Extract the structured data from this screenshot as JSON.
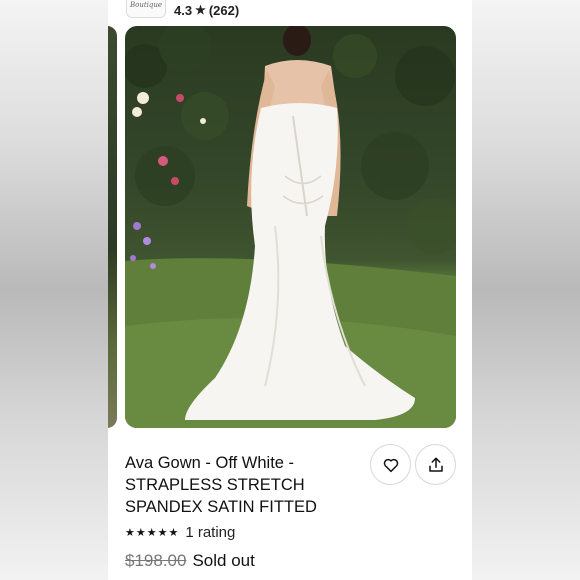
{
  "shop": {
    "logo_text": "Boutique",
    "rating": "4.3",
    "rating_count": "(262)"
  },
  "listing": {
    "title": "Ava Gown - Off White - STRAPLESS STRETCH SPANDEX SATIN FITTED",
    "stars": "★★★★★",
    "rating_label": "1 rating",
    "original_price": "$198.00",
    "status": "Sold out"
  },
  "icons": {
    "like": "heart-icon",
    "share": "share-icon",
    "star": "star-icon"
  },
  "colors": {
    "text": "#111111",
    "muted": "#777777",
    "border": "#d8d8d8"
  }
}
